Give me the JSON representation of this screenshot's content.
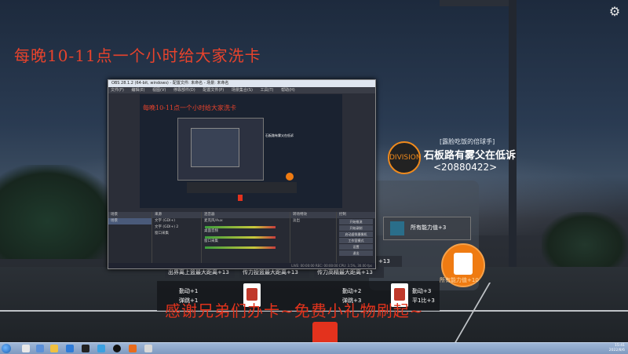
{
  "background": {
    "promo_text": "每晚10-11点一个小时给大家洗卡",
    "thanks_text": "感谢兄弟们办卡~免费小礼物刷起~"
  },
  "player": {
    "tag": "[露脸吃饭的倍球手]",
    "name": "石板路有雾父在低诉",
    "id": "<20880422>",
    "badge_text": "DIVISION"
  },
  "cards": {
    "big_stat": "所有能力值+3",
    "ability_label": "所有能力值+10",
    "rows": [
      {
        "label": "出界离上篮最大距离+13"
      },
      {
        "label": "传力投篮最大距离+13"
      },
      {
        "label": "出界离上篮最大距离+13"
      },
      {
        "label": "传力高精最大距离+13"
      },
      {
        "label": "+13"
      }
    ],
    "mini": [
      {
        "line1": "勤动+1",
        "line2": "弹跳+1"
      },
      {
        "line1": "勤动+2",
        "line2": "弹跳+3"
      },
      {
        "line1": "勤动+3",
        "line2": "平1比+3"
      }
    ]
  },
  "obs": {
    "title": "OBS 28.1.2 (64-bit, windows) - 配置文件: 未命名 - 场景: 未命名",
    "menu": [
      "文件(F)",
      "编辑(E)",
      "视图(V)",
      "停靠部件(D)",
      "配置文件(P)",
      "场景集合(S)",
      "工具(T)",
      "帮助(H)"
    ],
    "preview_promo": "每晚10-11点一个小时给大家洗卡",
    "preview_player": "石板路有雾父在低诉",
    "docks": {
      "scenes_head": "场景",
      "scene_item": "场景",
      "sources_head": "来源",
      "sources": [
        "文字 (GDI+)",
        "文字 (GDI+) 2",
        "窗口采集"
      ],
      "mixer_head": "混音器",
      "mixer_tracks": [
        "麦克风/Aux",
        "桌面音频",
        "窗口采集"
      ],
      "transitions_head": "转场特效",
      "transition_value": "淡出",
      "controls_head": "控制",
      "controls": [
        "开始推流",
        "开始录制",
        "启动虚拟摄像机",
        "工作室模式",
        "设置",
        "退出"
      ]
    },
    "status": "LIVE: 00:00:00  REC: 00:00:00  CPU: 3.5%, 30.00 fps"
  },
  "taskbar": {
    "time": "15:41",
    "date": "2022/8/6"
  },
  "colors": {
    "promo": "#e8432c",
    "thanks": "#e2331c",
    "orange": "#ef7b12"
  }
}
